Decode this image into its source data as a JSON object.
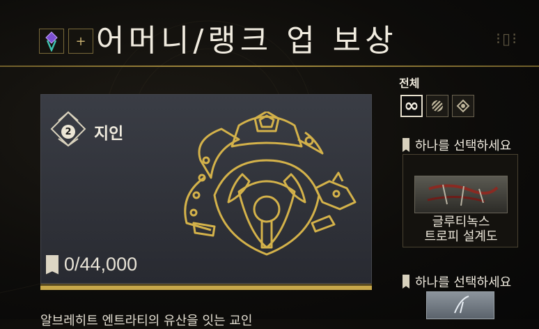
{
  "header": {
    "title": "어머니/랭크 업 보상",
    "plus": "+"
  },
  "rank": {
    "number": "2",
    "name": "지인"
  },
  "progress": {
    "text": "0/44,000"
  },
  "filter": {
    "label": "전체",
    "buttons": [
      {
        "icon": "infinity-icon",
        "glyph": "∞"
      },
      {
        "icon": "stripes-icon",
        "glyph": ""
      },
      {
        "icon": "mod-icon",
        "glyph": ""
      }
    ]
  },
  "rewards": [
    {
      "header": "하나를 선택하세요",
      "name_line1": "글루티녹스",
      "name_line2": "트로피 설계도"
    },
    {
      "header": "하나를 선택하세요"
    }
  ],
  "description": "알브레히트 엔트라티의 유산을 잇는 교인",
  "colors": {
    "gold": "#c8a84a",
    "panel": "#33363d"
  }
}
